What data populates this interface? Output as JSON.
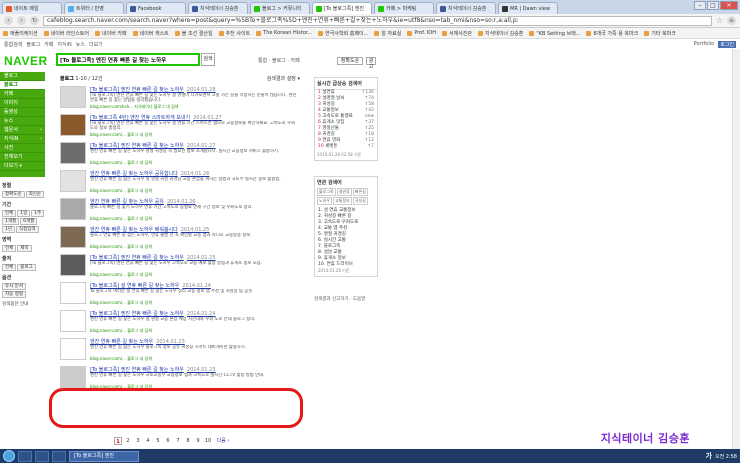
{
  "tabs": [
    {
      "label": "네이트 메일",
      "color": "#e35b2b",
      "active": false
    },
    {
      "label": "트위터 / 반영",
      "color": "#55acee",
      "active": false
    },
    {
      "label": "Facebook",
      "color": "#3b5998",
      "active": false
    },
    {
      "label": "지식테이너 김승훈",
      "color": "#3b5998",
      "active": false
    },
    {
      "label": "블로그 > 커뮤니티",
      "color": "#1ec800",
      "active": false
    },
    {
      "label": "[To 블로그족] 엔진",
      "color": "#1ec800",
      "active": true
    },
    {
      "label": "카페 > 마케팅",
      "color": "#1ec800",
      "active": false
    },
    {
      "label": "지식테이너 김승훈",
      "color": "#3b5998",
      "active": false
    },
    {
      "label": "MR | Dawn view",
      "color": "#333333",
      "active": false
    }
  ],
  "address_bar": {
    "url": "cafeblog.search.naver.com/search.naver?where=post&query=%5BTo+블로그족%5D+엔진+연휴+빠른+길+찾는+노하우&ie=utf8&nso=tab_nmi&nso=so:r,a:all,p:"
  },
  "bookmarks": [
    "애플리케이션",
    "네이버 라인스토어",
    "네이버 카페",
    "네이버 캐스트",
    "블 조선 결산일",
    "추천 사이트",
    "The Korean Histor...",
    "연극사학회 홈페이...",
    "알 자료실",
    "Prof. IOH",
    "서재사진관",
    "지식테이너 김승훈",
    "\"KB Setting 브래...",
    "8개국 가족 용 북마크",
    "기타 북마크"
  ],
  "top_nav": {
    "links": [
      "통합검색",
      "블로그",
      "카페",
      "지식iN",
      "뉴스",
      "더보기"
    ],
    "right_links": [
      "Portfolio",
      "로그인"
    ]
  },
  "brand": {
    "logo_text": "NAVER",
    "color": "#1ec800"
  },
  "search": {
    "query": "[To 블로그족] 엔진 연휴 빠른 길 찾는 노하우",
    "button": "검색",
    "right_tools": "통합 · 블로그 · 카페",
    "sort_label": "정확도순",
    "ad_label": "광고"
  },
  "left_nav": [
    {
      "label": "블로그"
    },
    {
      "label": "블로그",
      "active": true
    },
    {
      "label": "카페"
    },
    {
      "label": "이미지"
    },
    {
      "label": "동영상"
    },
    {
      "label": "뉴스"
    },
    {
      "label": "웹문서",
      "arrow": "›"
    },
    {
      "label": "지식iN",
      "arrow": "›"
    },
    {
      "label": "사전"
    },
    {
      "label": "전체보기"
    },
    {
      "label": "더보기 ▾"
    }
  ],
  "filters": [
    {
      "heading": "정렬",
      "options": [
        "정확도순",
        "최신순"
      ]
    },
    {
      "heading": "기간",
      "options": [
        "전체",
        "1일",
        "1주",
        "1개월",
        "6개월",
        "1년",
        "직접입력"
      ]
    },
    {
      "heading": "영역",
      "options": [
        "전체",
        "제목"
      ]
    },
    {
      "heading": "출처",
      "options": [
        "전체",
        "블로그"
      ]
    },
    {
      "heading": "옵션",
      "options": [
        "유사 문서",
        "자동 정렬"
      ]
    }
  ],
  "filter_note": "검색옵션 안내",
  "results_header": {
    "title": "블로그",
    "count": "1-10 / 12건",
    "option": "검색결과 설정 ▾"
  },
  "results": [
    {
      "title": "[To 블로그족] 엔진 연휴 빠른 길 찾는 노하우",
      "date": "2014.01.28",
      "desc": "[To 블로그족] 엔진 연휴 빠른 길 찾는 노하우 설 명절이 다가오면서 고향 가는 길을 걱정하는 분들이 많습니다. 엔진 연휴 빠른 길 찾는 방법을 정리했습니다.",
      "source": "blog.naver.com/ksh...  지식테이너  블로그 내 검색",
      "thumb": "#d8d8d8"
    },
    {
      "title": "[To 블로그족 4탄] 엔진 연휴 스마트하게 보내기",
      "date": "2014.01.27",
      "desc": "[To 블로그족] 엔진 연휴 빠른 길 찾는 노하우 설 연휴 기간 스마트폰 앱으로 교통정보를 확인하세요. 고속도로 우회 도로 정보 총정리.",
      "source": "blog.naver.com/...  블로그 내 검색",
      "thumb": "#8b5a2b"
    },
    {
      "title": "[To 블로그족] 엔진 연휴 빠른 길 찾는 노하우",
      "date": "2014.01.27",
      "desc": "엔진 연휴 빠른 길 찾는 노하우 명절 귀성길 꼭 필요한 정보 소개합니다. 실시간 교통정보 서비스 활용하기.",
      "source": "blog.naver.com/...  블로그 내 검색",
      "thumb": "#6d6d6d"
    },
    {
      "title": "엔진 연휴 빠른 길 찾는 노하우 공유합니다",
      "date": "2014.01.26",
      "desc": "엔진 연휴 빠른 길 찾는 노하우 설 명절 귀성 귀경길 교통 혼잡을 피하는 방법과 국토부 실시간 정보 활용법.",
      "source": "blog.naver.com/...  블로그 내 검색",
      "thumb": "#e2e2e2"
    },
    {
      "title": "엔진 연휴 빠른 길 찾는 노하우 공유",
      "date": "2014.01.26",
      "desc": "블로그족 빠른 길 찾기 노하우 연휴 기간 고속도로 통행료 면제 구간 정보 및 우회도로 정리.",
      "source": "blog.naver.com/...  블로그 내 검색",
      "thumb": "#a9a9a9"
    },
    {
      "title": "엔진 연휴 빠른 길 찾는 노하우 배워봅시다",
      "date": "2014.01.25",
      "desc": "블로그 연휴 빠른 길 찾는 노하우, 연휴 출발 전 꼭 확인할 교통 앱과 라디오 교통방송 정보.",
      "source": "blog.naver.com/...  블로그 내 검색",
      "thumb": "#7e6a54"
    },
    {
      "title": "[To 블로그족] 엔진 연휴 빠른 길 찾는 노하우",
      "date": "2014.01.25",
      "desc": "[To 블로그족] 엔진 연휴 빠른 길 찾는 노하우 고속도로 교통 예보 활용 방법과 휴게소 정보 모음.",
      "source": "blog.naver.com/...  블로그 내 검색",
      "thumb": "#5c5c5c"
    },
    {
      "title": "[To 블로그족] 설 연휴 빠른 길 찾는 노하우",
      "date": "2014.01.24",
      "desc": "To 블로그족 여러분 설 연휴 빠른 길 찾는 노하우 정리 교통 정보 앱 추천 및 귀성길 팁 공유.",
      "source": "blog.naver.com/...  블로그 내 검색",
      "thumb": "#ffffff"
    },
    {
      "title": "[To 블로그족] 엔진 연휴 빠른 길 찾는 노하우",
      "date": "2014.01.24",
      "desc": "엔진 연휴 빠른 길 찾는 노하우 설 명절 교통 혼잡 예상 시간대와 우회 도로 안내 블로그 정리.",
      "source": "blog.naver.com/...  블로그 내 검색",
      "thumb": "#ffffff"
    },
    {
      "title": "엔진 연휴 빠른 길 찾는 노하우",
      "date": "2014.01.23",
      "desc": "엔진 연휴 빠른 길 찾는 노하우 블로그족 정보 공유 귀성길 스마트 내비게이션 활용하기.",
      "source": "blog.naver.com/...  블로그 내 검색",
      "thumb": "#ffffff"
    },
    {
      "title": "[To 블로그족] 엔진 연휴 빠른 길 찾는 노하우",
      "date": "2014.01.23",
      "desc": "엔진 연휴 빠른 길 찾는 노하우 국토교통부 교통정보 앱과 고속도로 실시간 CCTV 활용 방법 안내.",
      "source": "blog.naver.com/...  블로그 내 검색",
      "thumb": "#cccccc"
    }
  ],
  "pagination": {
    "pages": [
      "1",
      "2",
      "3",
      "4",
      "5",
      "6",
      "7",
      "8",
      "9",
      "10"
    ],
    "current": "1",
    "next": "다음 ›"
  },
  "realtime": {
    "heading": "실시간 급상승 검색어",
    "items": [
      {
        "rank": "1",
        "term": "설연휴",
        "val": "↑136"
      },
      {
        "rank": "2",
        "term": "설명절 날씨",
        "val": "↑74"
      },
      {
        "rank": "3",
        "term": "귀성길",
        "val": "↑58"
      },
      {
        "rank": "4",
        "term": "교통정보",
        "val": "↑42"
      },
      {
        "rank": "5",
        "term": "고속도로 통행료",
        "val": "new"
      },
      {
        "rank": "6",
        "term": "휴게소 맛집",
        "val": "↑37"
      },
      {
        "rank": "7",
        "term": "명절선물",
        "val": "↑25"
      },
      {
        "rank": "8",
        "term": "귀경길",
        "val": "↑18"
      },
      {
        "rank": "9",
        "term": "연휴 영화",
        "val": "↑12"
      },
      {
        "rank": "10",
        "term": "세뱃돈",
        "val": "↑7"
      }
    ],
    "footer": "2014.01.28 02:58 기준"
  },
  "related": {
    "heading": "연관 검색어",
    "tags": [
      "블로그족",
      "설연휴",
      "빠른길",
      "노하우",
      "교통정보",
      "귀성길"
    ],
    "list": [
      "1. 설 연휴 교통정보",
      "2. 귀성길 빠른 길",
      "3. 고속도로 우회도로",
      "4. 교통 앱 추천",
      "5. 명절 귀경길",
      "6. 실시간 교통",
      "7. 블로그족",
      "8. 설날 교통",
      "9. 휴게소 정보",
      "10. 연휴 드라이브"
    ],
    "footer": "2014.01.28 기준"
  },
  "bottom_note": "검색결과 신고하기 · 도움말",
  "watermark": "지식테이너 김승훈",
  "taskbar": {
    "active_window": "[To 블로그족] 엔진",
    "time": "오전 2:58",
    "lang": "가"
  }
}
